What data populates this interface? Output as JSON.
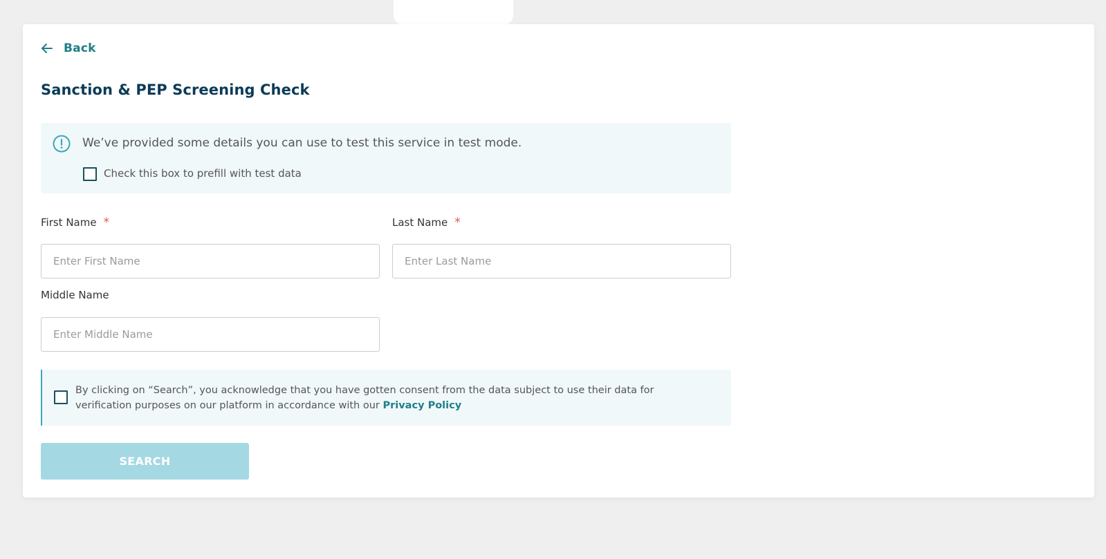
{
  "header": {
    "back_label": "Back",
    "title": "Sanction & PEP Screening Check"
  },
  "info": {
    "message": "We’ve provided some details you can use to test this service in test mode.",
    "prefill_label": "Check this box to prefill with test data",
    "prefill_checked": false,
    "icon": "exclamation-circle-icon"
  },
  "form": {
    "first_name": {
      "label": "First Name",
      "required_mark": "*",
      "placeholder": "Enter First Name",
      "value": ""
    },
    "last_name": {
      "label": "Last Name",
      "required_mark": "*",
      "placeholder": "Enter Last Name",
      "value": ""
    },
    "middle_name": {
      "label": "Middle Name",
      "placeholder": "Enter Middle Name",
      "value": ""
    }
  },
  "consent": {
    "text": "By clicking on “Search”, you acknowledge that you have gotten consent from the data subject to use their data for verification purposes on our platform in accordance with our ",
    "link_label": "Privacy Policy",
    "checked": false
  },
  "search_button_label": "SEARCH",
  "colors": {
    "accent": "#1f7f8a",
    "title": "#0b3b57",
    "required": "#e0563f",
    "info_bg": "#f1f8fa",
    "button_disabled": "#a4d8e3"
  }
}
